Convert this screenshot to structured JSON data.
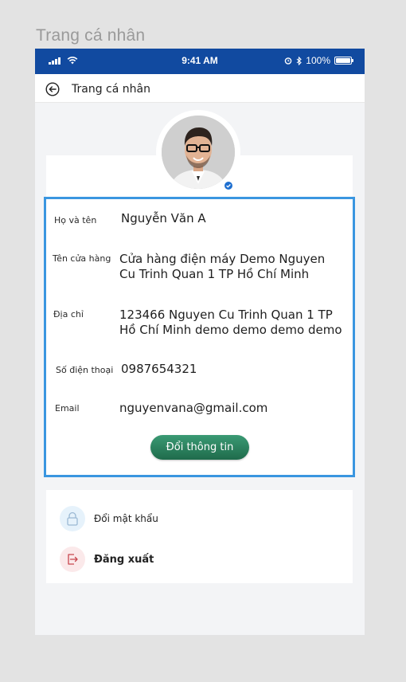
{
  "canvas_title": "Trang cá nhân",
  "status_bar": {
    "time": "9:41 AM",
    "battery_percent": "100%",
    "background": "#114aa0"
  },
  "header": {
    "title": "Trang cá nhân",
    "back_icon": "back-arrow-circle-icon"
  },
  "profile": {
    "avatar_icon": "user-avatar",
    "badge_icon": "verified-badge-icon",
    "fields": [
      {
        "label": "Họ và tên",
        "value": "Nguyễn Văn A"
      },
      {
        "label": "Tên cửa hàng",
        "value": "Cửa hàng điện máy Demo Nguyen Cu Trinh Quan 1 TP Hồ Chí Minh"
      },
      {
        "label": "Địa chỉ",
        "value": "123466  Nguyen Cu Trinh Quan 1 TP Hồ Chí Minh demo demo demo demo"
      },
      {
        "label": "Số điện thoại",
        "value": "0987654321"
      },
      {
        "label": "Email",
        "value": "nguyenvana@gmail.com"
      }
    ],
    "update_button": "Đổi thông tin",
    "highlight_color": "#3a96e0",
    "button_color": "#2a8060"
  },
  "actions": [
    {
      "label": "Đổi mật khẩu",
      "icon": "lock-icon"
    },
    {
      "label": "Đăng xuất",
      "icon": "logout-icon"
    }
  ]
}
